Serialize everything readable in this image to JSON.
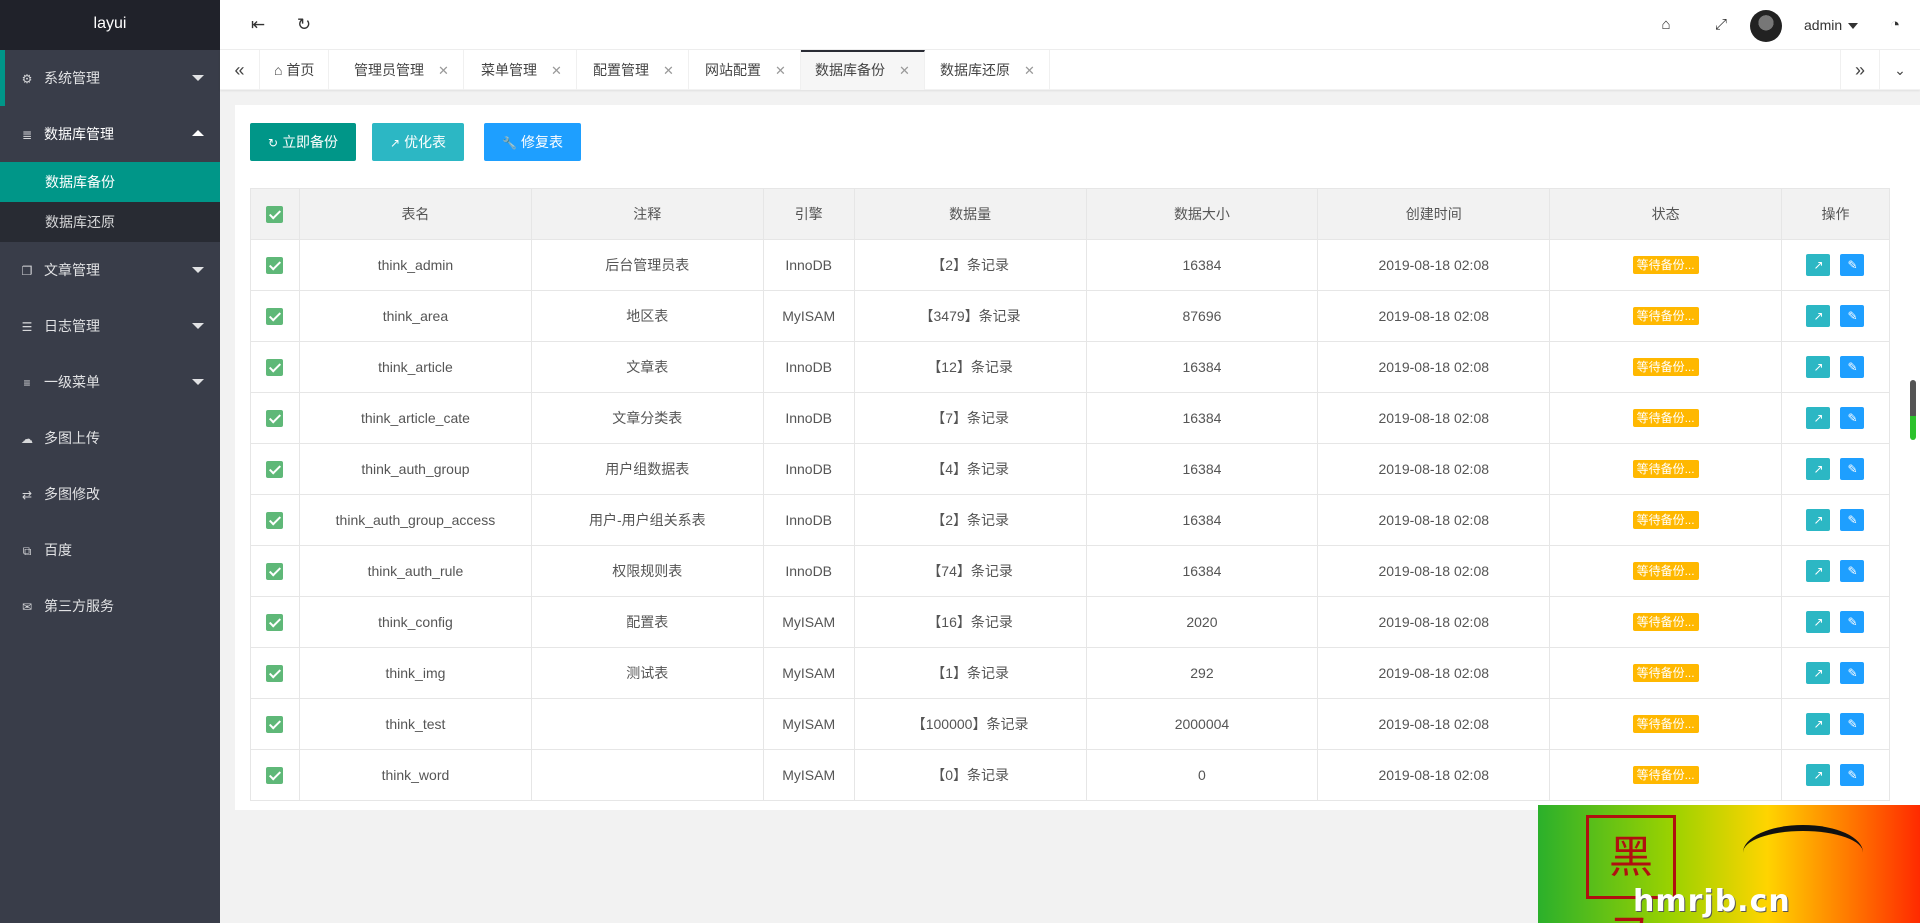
{
  "sidebar": {
    "logo": "layui",
    "items": [
      {
        "label": "系统管理"
      },
      {
        "label": "数据库管理"
      },
      {
        "label": "文章管理"
      },
      {
        "label": "日志管理"
      },
      {
        "label": "一级菜单"
      },
      {
        "label": "多图上传"
      },
      {
        "label": "多图修改"
      },
      {
        "label": "百度"
      },
      {
        "label": "第三方服务"
      }
    ],
    "sub_items": [
      {
        "label": "数据库备份"
      },
      {
        "label": "数据库还原"
      }
    ]
  },
  "header": {
    "user": "admin"
  },
  "tabs": [
    {
      "label": "首页"
    },
    {
      "label": "管理员管理"
    },
    {
      "label": "菜单管理"
    },
    {
      "label": "配置管理"
    },
    {
      "label": "网站配置"
    },
    {
      "label": "数据库备份"
    },
    {
      "label": "数据库还原"
    }
  ],
  "toolbar": {
    "backup": "立即备份",
    "optimize": "优化表",
    "repair": "修复表"
  },
  "table": {
    "headers": [
      "表名",
      "注释",
      "引擎",
      "数据量",
      "数据大小",
      "创建时间",
      "状态",
      "操作"
    ],
    "rows": [
      [
        "think_admin",
        "后台管理员表",
        "InnoDB",
        "【2】条记录",
        "16384",
        "2019-08-18 02:08",
        "等待备份..."
      ],
      [
        "think_area",
        "地区表",
        "MyISAM",
        "【3479】条记录",
        "87696",
        "2019-08-18 02:08",
        "等待备份..."
      ],
      [
        "think_article",
        "文章表",
        "InnoDB",
        "【12】条记录",
        "16384",
        "2019-08-18 02:08",
        "等待备份..."
      ],
      [
        "think_article_cate",
        "文章分类表",
        "InnoDB",
        "【7】条记录",
        "16384",
        "2019-08-18 02:08",
        "等待备份..."
      ],
      [
        "think_auth_group",
        "用户组数据表",
        "InnoDB",
        "【4】条记录",
        "16384",
        "2019-08-18 02:08",
        "等待备份..."
      ],
      [
        "think_auth_group_access",
        "用户-用户组关系表",
        "InnoDB",
        "【2】条记录",
        "16384",
        "2019-08-18 02:08",
        "等待备份..."
      ],
      [
        "think_auth_rule",
        "权限规则表",
        "InnoDB",
        "【74】条记录",
        "16384",
        "2019-08-18 02:08",
        "等待备份..."
      ],
      [
        "think_config",
        "配置表",
        "MyISAM",
        "【16】条记录",
        "2020",
        "2019-08-18 02:08",
        "等待备份..."
      ],
      [
        "think_img",
        "测试表",
        "MyISAM",
        "【1】条记录",
        "292",
        "2019-08-18 02:08",
        "等待备份..."
      ],
      [
        "think_test",
        "",
        "MyISAM",
        "【100000】条记录",
        "2000004",
        "2019-08-18 02:08",
        "等待备份..."
      ],
      [
        "think_word",
        "",
        "MyISAM",
        "【0】条记录",
        "0",
        "2019-08-18 02:08",
        "等待备份..."
      ]
    ]
  },
  "watermark": {
    "seal": "黑马",
    "site": "hmrjb.cn"
  },
  "colors": {
    "sidebar": "#393d49",
    "accent": "#009688",
    "teal": "#2cb7c4",
    "blue": "#1e9fff",
    "warn": "#ffb800",
    "check": "#5fb878"
  },
  "icons": {
    "menu_toggle": "indent-icon",
    "refresh": "refresh-icon",
    "tag": "tag-icon",
    "fullscreen": "fullscreen-icon",
    "theme": "palette-icon",
    "optimize": "chart-icon",
    "repair": "wrench-icon"
  }
}
